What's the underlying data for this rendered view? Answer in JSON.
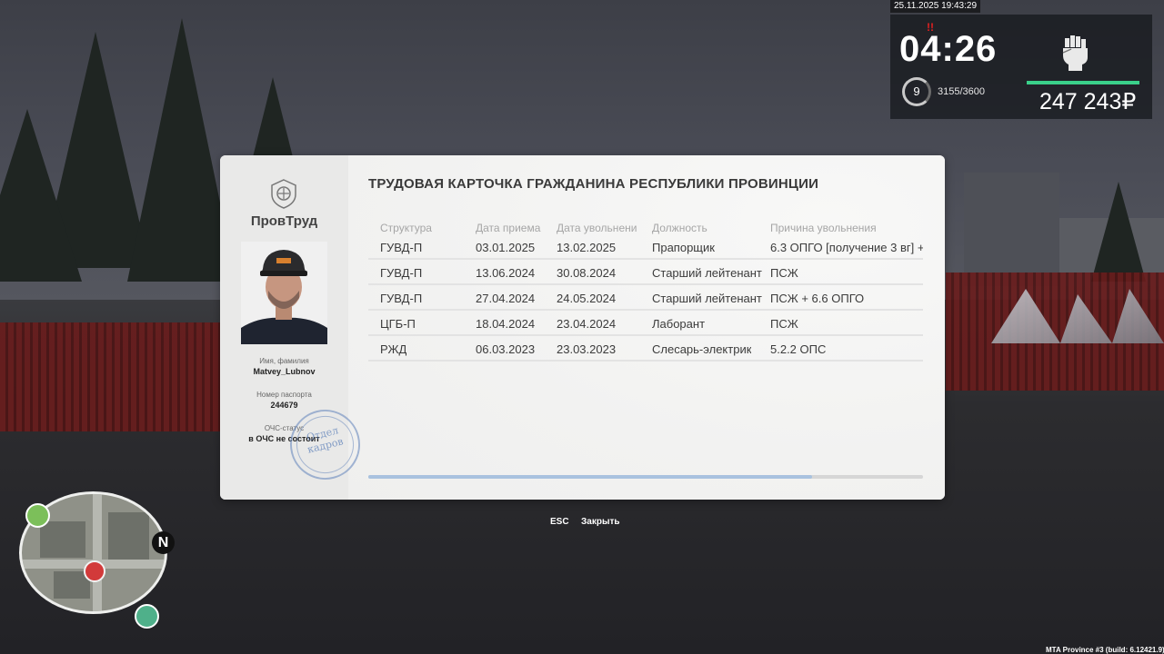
{
  "hud": {
    "datetime": "25.11.2025 19:43:29",
    "clock": "04:26",
    "wanted": "!!",
    "level": "9",
    "xp": "3155/3600",
    "money": "247 243₽"
  },
  "card": {
    "brand": "ПровТруд",
    "title": "ТРУДОВАЯ КАРТОЧКА ГРАЖДАНИНА РЕСПУБЛИКИ ПРОВИНЦИИ",
    "name_label": "Имя, фамилия",
    "name_value": "Matvey_Lubnov",
    "passport_label": "Номер паспорта",
    "passport_value": "244679",
    "ochs_label": "ОЧС-статус",
    "ochs_value": "в ОЧС не состоит",
    "stamp_line1": "Отдел",
    "stamp_line2": "кадров",
    "columns": [
      "Структура",
      "Дата приема",
      "Дата увольнени",
      "Должность",
      "Причина увольнения"
    ],
    "rows": [
      [
        "ГУВД-П",
        "03.01.2025",
        "13.02.2025",
        "Прапорщик",
        "6.3 ОПГО [получение 3 вг] +"
      ],
      [
        "ГУВД-П",
        "13.06.2024",
        "30.08.2024",
        "Старший лейтенант",
        "ПСЖ"
      ],
      [
        "ГУВД-П",
        "27.04.2024",
        "24.05.2024",
        "Старший лейтенант",
        "ПСЖ + 6.6 ОПГО"
      ],
      [
        "ЦГБ-П",
        "18.04.2024",
        "23.04.2024",
        "Лаборант",
        "ПСЖ"
      ],
      [
        "РЖД",
        "06.03.2023",
        "23.03.2023",
        "Слесарь-электрик",
        "5.2.2 ОПС"
      ]
    ],
    "scroll_fraction": 0.8
  },
  "footer": {
    "key": "ESC",
    "label": "Закрыть"
  },
  "minimap": {
    "north": "N"
  },
  "build": "MTA Province #3 (build: 6.12421.9)",
  "colors": {
    "money_bar": "#3ad08a",
    "wanted": "#e02020",
    "scroll_thumb": "#a9c2df"
  }
}
